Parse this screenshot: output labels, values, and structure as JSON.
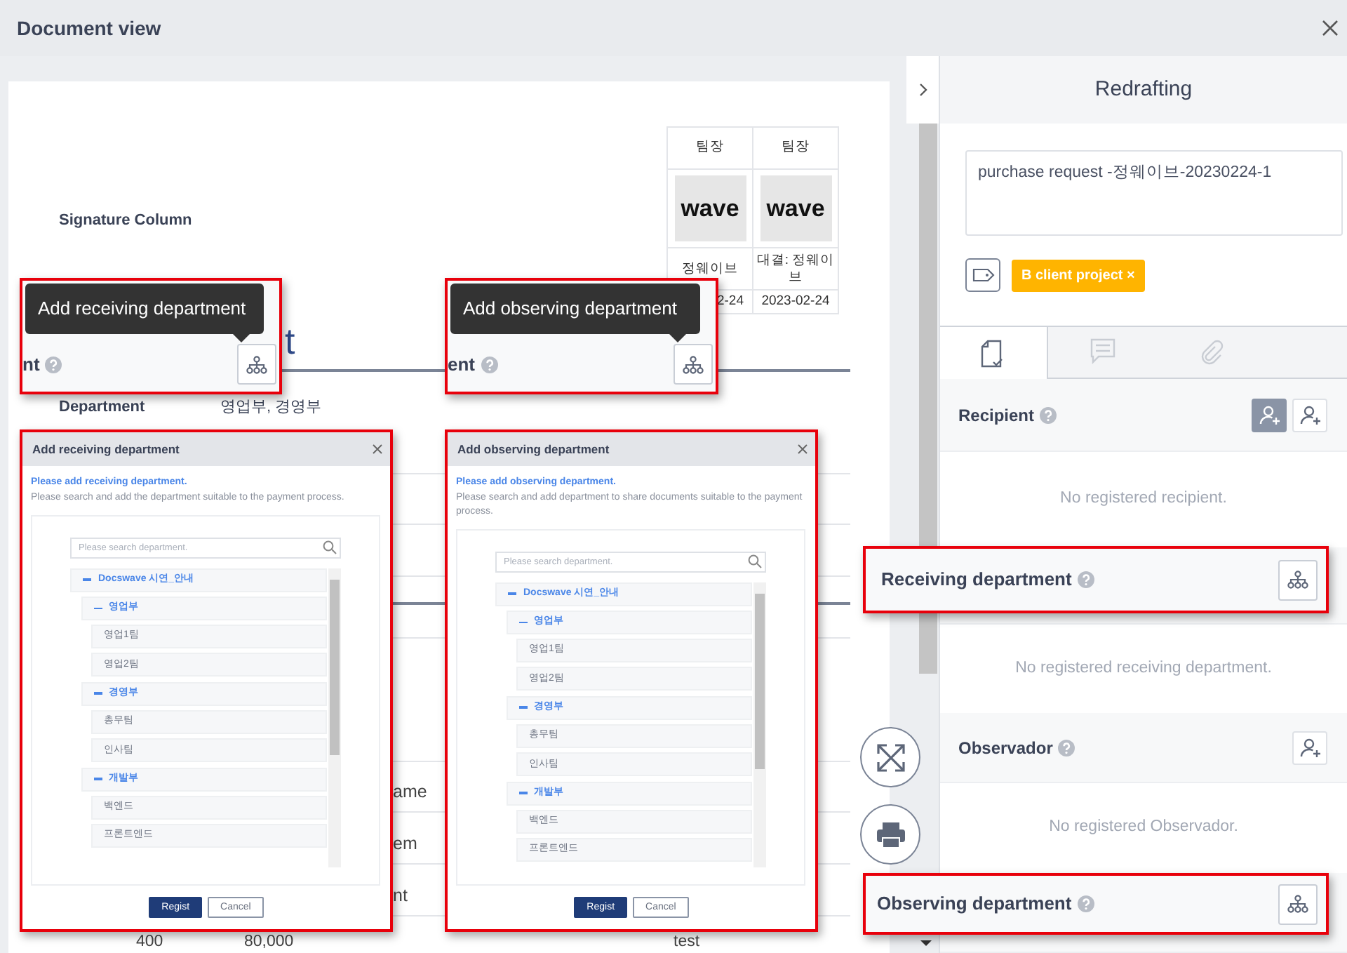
{
  "window": {
    "title": "Document view"
  },
  "document": {
    "signature_label": "Signature Column",
    "approvals": [
      {
        "title": "팀장",
        "signature": "wave",
        "name": "정웨이브",
        "date": "2-24"
      },
      {
        "title": "팀장",
        "signature": "wave",
        "name": "대결: 정웨이브",
        "date": "2023-02-24"
      }
    ],
    "heading_fragment": "t",
    "fields": [
      {
        "label": "Department",
        "value": "영업부, 경영부"
      }
    ],
    "column_fragments": [
      "ame",
      "em",
      "nt"
    ],
    "row_cells": [
      "400",
      "80,000",
      "test"
    ]
  },
  "panel": {
    "title": "Redrafting",
    "subject": "purchase request -정웨이브-20230224-1",
    "tags": [
      {
        "label": "B client project ×",
        "color": "#ffb400"
      }
    ],
    "tabs": [
      {
        "kind": "approval",
        "selected": true
      },
      {
        "kind": "comments",
        "selected": false
      },
      {
        "kind": "attachments",
        "selected": false
      }
    ],
    "sections": [
      {
        "title": "Recipient",
        "buttons": [
          {
            "kind": "add-person",
            "selected": true
          },
          {
            "kind": "add-person",
            "selected": false
          }
        ],
        "empty": "No registered recipient."
      },
      {
        "empty": "No registered receiving department."
      },
      {
        "title": "Observador",
        "buttons": [
          {
            "kind": "add-person",
            "selected": false
          }
        ],
        "empty": "No registered Observador."
      }
    ]
  },
  "callouts": [
    {
      "kind": "tooltip",
      "tooltip": "Add receiving department",
      "label": "nt"
    },
    {
      "kind": "tooltip",
      "tooltip": "Add observing department",
      "label": "ent"
    },
    {
      "kind": "header",
      "label": "Receiving department"
    },
    {
      "kind": "header",
      "label": "Observing department"
    }
  ],
  "dialogs": [
    {
      "title": "Add receiving department",
      "hint_title": "Please add receiving department.",
      "hint": "Please search and add the department suitable to the payment process.",
      "placeholder": "Please search department.",
      "tree": [
        {
          "label": "Docswave 시연_안내",
          "expanded": true,
          "children": [
            {
              "label": "영업부",
              "expanded": true,
              "children": [
                {
                  "label": "영업1팀"
                },
                {
                  "label": "영업2팀"
                }
              ]
            },
            {
              "label": "경영부",
              "expanded": true,
              "children": [
                {
                  "label": "총무팀"
                },
                {
                  "label": "인사팀"
                }
              ]
            },
            {
              "label": "개발부",
              "expanded": true,
              "children": [
                {
                  "label": "백엔드"
                },
                {
                  "label": "프론트엔드"
                }
              ]
            }
          ]
        }
      ],
      "buttons": [
        {
          "label": "Regist",
          "kind": "primary"
        },
        {
          "label": "Cancel",
          "kind": "secondary"
        }
      ]
    },
    {
      "title": "Add observing department",
      "hint_title": "Please add observing department.",
      "hint": "Please search and add department to share documents suitable to the payment process.",
      "placeholder": "Please search department.",
      "tree": [
        {
          "label": "Docswave 시연_안내",
          "expanded": true,
          "children": [
            {
              "label": "영업부",
              "expanded": true,
              "children": [
                {
                  "label": "영업1팀"
                },
                {
                  "label": "영업2팀"
                }
              ]
            },
            {
              "label": "경영부",
              "expanded": true,
              "children": [
                {
                  "label": "총무팀"
                },
                {
                  "label": "인사팀"
                }
              ]
            },
            {
              "label": "개발부",
              "expanded": true,
              "children": [
                {
                  "label": "백엔드"
                },
                {
                  "label": "프론트엔드"
                }
              ]
            }
          ]
        }
      ],
      "buttons": [
        {
          "label": "Regist",
          "kind": "primary"
        },
        {
          "label": "Cancel",
          "kind": "secondary"
        }
      ]
    }
  ]
}
